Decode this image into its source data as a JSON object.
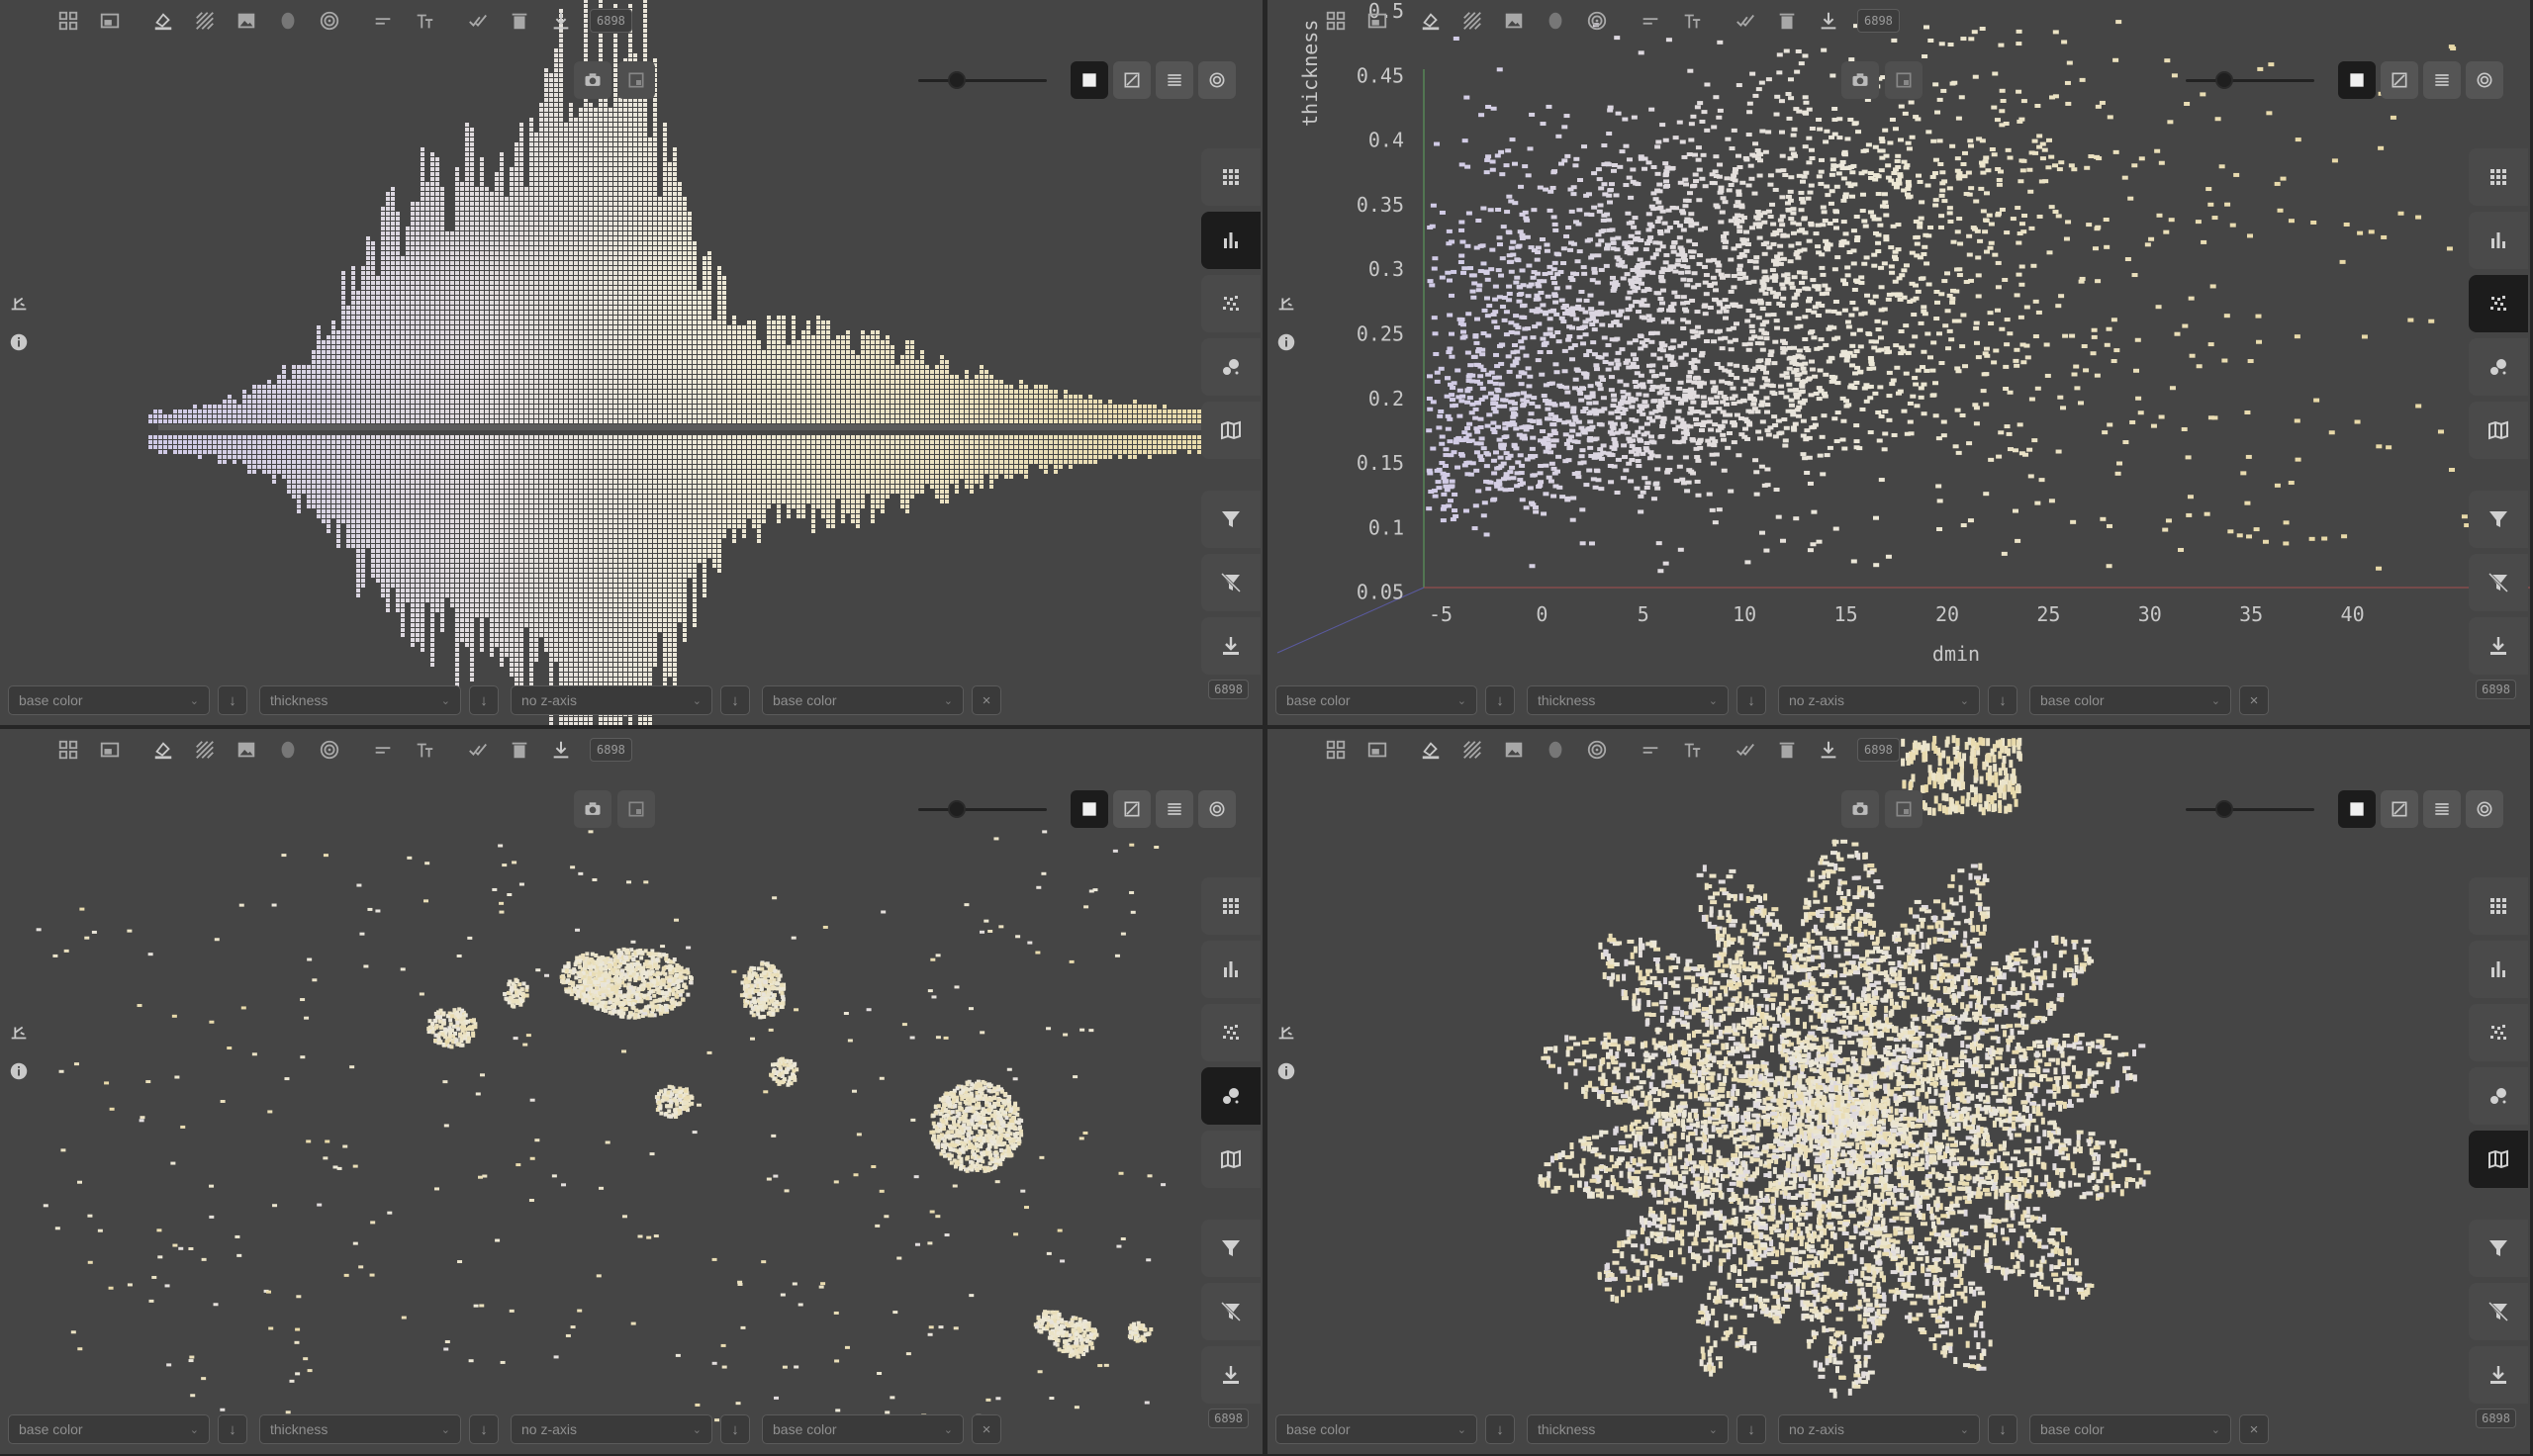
{
  "point_count": "6898",
  "colors": {
    "panel_bg": "#454545",
    "voxel_light": "#ece8d8",
    "voxel_lavender": "#cfc9e6",
    "voxel_yellow": "#e8d9a8",
    "active_button": "#1c1c1c"
  },
  "toolbar_icons": [
    "grid-icon",
    "window-icon",
    "fill-color-icon",
    "texture-icon",
    "image-icon",
    "shape-icon",
    "target-icon",
    "line-width-icon",
    "text-size-icon",
    "check-icon",
    "delete-icon",
    "download-icon"
  ],
  "camera_icons": [
    "camera-icon",
    "frame-icon"
  ],
  "render_modes": [
    "solid-mode-icon",
    "shaded-mode-icon",
    "lines-mode-icon",
    "circle-mode-icon"
  ],
  "view_buttons": [
    "grid-view-icon",
    "histogram-view-icon",
    "scatter-view-icon",
    "cluster-view-icon",
    "map-view-icon"
  ],
  "tool_buttons": [
    "filter-icon",
    "clear-filter-icon",
    "export-icon"
  ],
  "panels": [
    {
      "id": "histogram",
      "active_view": 1,
      "slider_fraction": 0.3,
      "selects": [
        "base color",
        "thickness",
        "no z-axis",
        "base color"
      ]
    },
    {
      "id": "scatter",
      "active_view": 2,
      "slider_fraction": 0.3,
      "selects": [
        "base color",
        "thickness",
        "no z-axis",
        "base color"
      ],
      "chart": {
        "ylabel": "thickness",
        "xlabel": "dmin",
        "yticks": [
          "0.5",
          "0.45",
          "0.4",
          "0.35",
          "0.3",
          "0.25",
          "0.2",
          "0.15",
          "0.1",
          "0.05"
        ],
        "xticks": [
          "-5",
          "0",
          "5",
          "10",
          "15",
          "20",
          "25",
          "30",
          "35",
          "40"
        ]
      }
    },
    {
      "id": "cluster",
      "active_view": 3,
      "slider_fraction": 0.3,
      "selects": [
        "base color",
        "thickness",
        "no z-axis",
        "base color"
      ]
    },
    {
      "id": "map",
      "active_view": 4,
      "slider_fraction": 0.3,
      "selects": [
        "base color",
        "thickness",
        "no z-axis",
        "base color"
      ]
    }
  ]
}
